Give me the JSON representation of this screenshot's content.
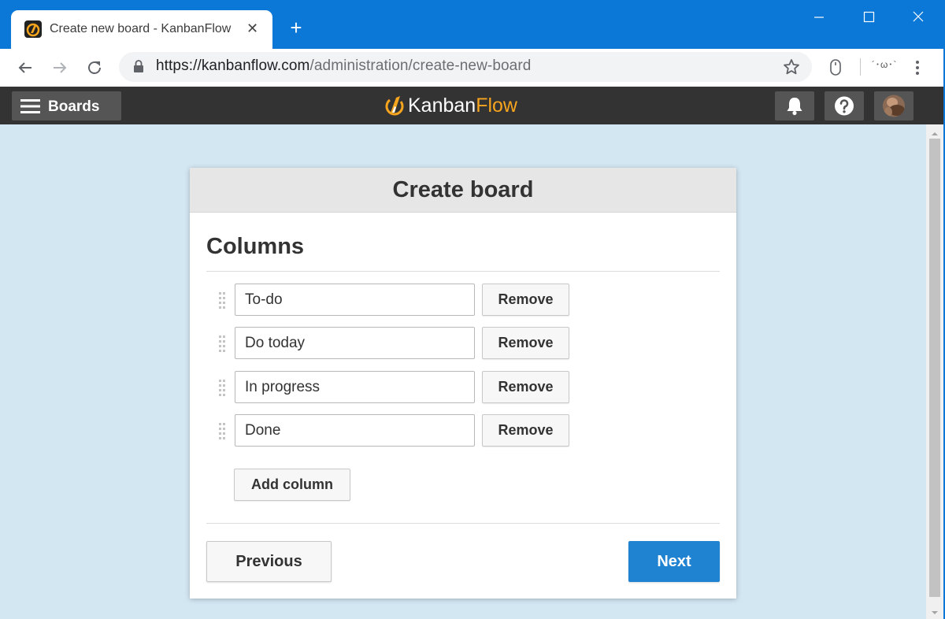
{
  "browser": {
    "tab_title": "Create new board - KanbanFlow",
    "tab_close": "✕",
    "new_tab": "+",
    "url_host": "https://kanbanflow.com",
    "url_path": "/administration/create-new-board",
    "extension_face": "´･ω･`"
  },
  "header": {
    "boards_label": "Boards",
    "logo_part1": "Kanban",
    "logo_part2": "Flow",
    "accent_color": "#f7a51e",
    "header_bg": "#333333"
  },
  "dialog": {
    "title": "Create board",
    "section_title": "Columns",
    "columns": [
      {
        "value": "To-do",
        "remove_label": "Remove"
      },
      {
        "value": "Do today",
        "remove_label": "Remove"
      },
      {
        "value": "In progress",
        "remove_label": "Remove"
      },
      {
        "value": "Done",
        "remove_label": "Remove"
      }
    ],
    "add_column_label": "Add column",
    "previous_label": "Previous",
    "next_label": "Next",
    "primary_color": "#2083d2"
  },
  "icons": {
    "back": "arrow-left-icon",
    "forward": "arrow-right-icon",
    "reload": "reload-icon",
    "lock": "lock-icon",
    "bookmark": "star-icon",
    "menu": "hamburger-icon",
    "notifications": "bell-icon",
    "help": "question-icon"
  }
}
